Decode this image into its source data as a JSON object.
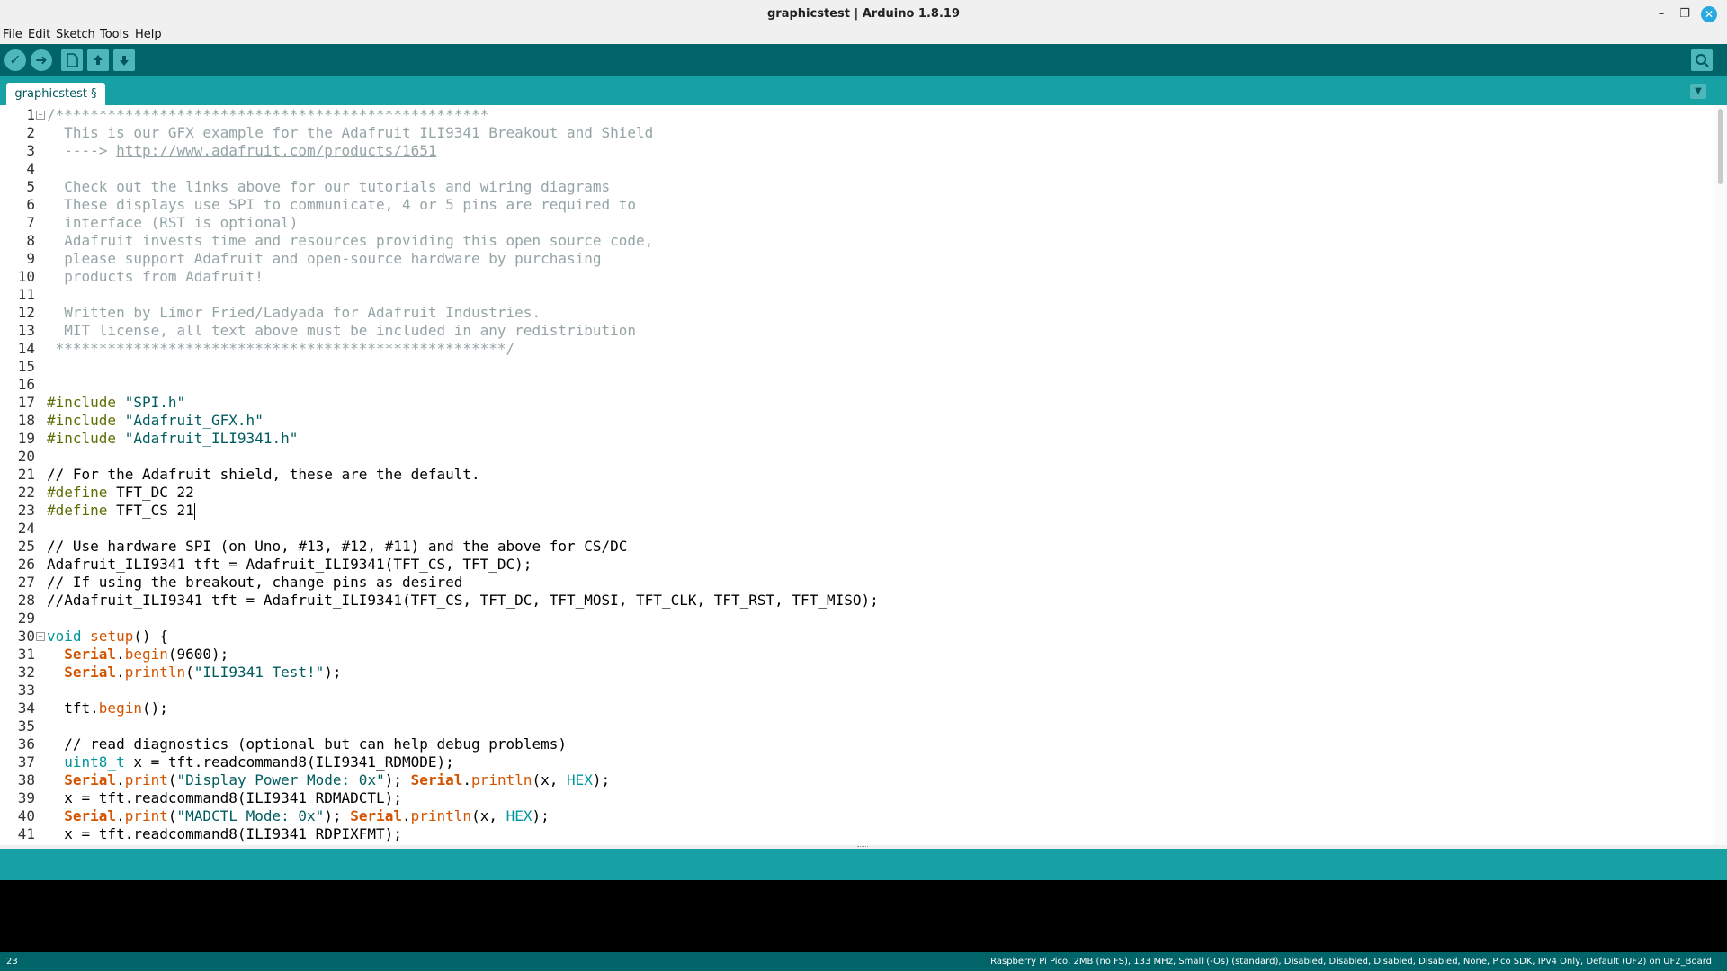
{
  "window": {
    "title": "graphicstest | Arduino 1.8.19",
    "controls": [
      "minimize-icon",
      "restore-icon",
      "close-icon"
    ]
  },
  "menu": [
    "File",
    "Edit",
    "Sketch",
    "Tools",
    "Help"
  ],
  "toolbar": {
    "buttons": [
      "verify-icon",
      "upload-icon",
      "new-icon",
      "open-icon",
      "save-icon"
    ],
    "right": "serial-monitor-icon"
  },
  "tabs": [
    {
      "label": "graphicstest §",
      "active": true
    }
  ],
  "tab_menu_icon": "chevron-down-icon",
  "colors": {
    "toolbar": "#006468",
    "tabbar": "#17a1a5",
    "comment": "#95a5a6",
    "preprocessor": "#5e6d03",
    "keyword": "#00979c",
    "function": "#d35400"
  },
  "editor": {
    "cursor_line": 23,
    "lines": [
      {
        "n": "1",
        "fold": true,
        "tokens": [
          [
            "/**************************************************",
            "comment"
          ]
        ]
      },
      {
        "n": "2",
        "tokens": [
          [
            "  This is our GFX example for the Adafruit ILI9341 Breakout and Shield",
            "comment"
          ]
        ]
      },
      {
        "n": "3",
        "tokens": [
          [
            "  ----> ",
            "comment"
          ],
          [
            "http://www.adafruit.com/products/1651",
            "url"
          ]
        ]
      },
      {
        "n": "4",
        "tokens": []
      },
      {
        "n": "5",
        "tokens": [
          [
            "  Check out the links above for our tutorials and wiring diagrams",
            "comment"
          ]
        ]
      },
      {
        "n": "6",
        "tokens": [
          [
            "  These displays use SPI to communicate, 4 or 5 pins are required to",
            "comment"
          ]
        ]
      },
      {
        "n": "7",
        "tokens": [
          [
            "  interface (RST is optional)",
            "comment"
          ]
        ]
      },
      {
        "n": "8",
        "tokens": [
          [
            "  Adafruit invests time and resources providing this open source code,",
            "comment"
          ]
        ]
      },
      {
        "n": "9",
        "tokens": [
          [
            "  please support Adafruit and open-source hardware by purchasing",
            "comment"
          ]
        ]
      },
      {
        "n": "10",
        "tokens": [
          [
            "  products from Adafruit!",
            "comment"
          ]
        ]
      },
      {
        "n": "11",
        "tokens": []
      },
      {
        "n": "12",
        "tokens": [
          [
            "  Written by Limor Fried/Ladyada for Adafruit Industries.",
            "comment"
          ]
        ]
      },
      {
        "n": "13",
        "tokens": [
          [
            "  MIT license, all text above must be included in any redistribution",
            "comment"
          ]
        ]
      },
      {
        "n": "14",
        "tokens": [
          [
            " ****************************************************/",
            "comment"
          ]
        ]
      },
      {
        "n": "15",
        "tokens": []
      },
      {
        "n": "16",
        "tokens": []
      },
      {
        "n": "17",
        "tokens": [
          [
            "#include",
            "pre"
          ],
          [
            " \"SPI.h\"",
            "str"
          ]
        ]
      },
      {
        "n": "18",
        "tokens": [
          [
            "#include",
            "pre"
          ],
          [
            " \"Adafruit_GFX.h\"",
            "str"
          ]
        ]
      },
      {
        "n": "19",
        "tokens": [
          [
            "#include",
            "pre"
          ],
          [
            " \"Adafruit_ILI9341.h\"",
            "str"
          ]
        ]
      },
      {
        "n": "20",
        "tokens": []
      },
      {
        "n": "21",
        "tokens": [
          [
            "// For the Adafruit shield, these are the default.",
            "plain"
          ]
        ]
      },
      {
        "n": "22",
        "tokens": [
          [
            "#define",
            "pre"
          ],
          [
            " TFT_DC 22",
            "plain"
          ]
        ]
      },
      {
        "n": "23",
        "tokens": [
          [
            "#define",
            "pre"
          ],
          [
            " TFT_CS 21",
            "plain"
          ]
        ],
        "caret": true
      },
      {
        "n": "24",
        "tokens": []
      },
      {
        "n": "25",
        "tokens": [
          [
            "// Use hardware SPI (on Uno, #13, #12, #11) and the above for CS/DC",
            "plain"
          ]
        ]
      },
      {
        "n": "26",
        "tokens": [
          [
            "Adafruit_ILI9341 tft = Adafruit_ILI9341(TFT_CS, TFT_DC);",
            "plain"
          ]
        ]
      },
      {
        "n": "27",
        "tokens": [
          [
            "// If using the breakout, change pins as desired",
            "plain"
          ]
        ]
      },
      {
        "n": "28",
        "tokens": [
          [
            "//Adafruit_ILI9341 tft = Adafruit_ILI9341(TFT_CS, TFT_DC, TFT_MOSI, TFT_CLK, TFT_RST, TFT_MISO);",
            "plain"
          ]
        ]
      },
      {
        "n": "29",
        "tokens": []
      },
      {
        "n": "30",
        "fold": true,
        "tokens": [
          [
            "void",
            "kw"
          ],
          [
            " ",
            "plain"
          ],
          [
            "setup",
            "fn"
          ],
          [
            "() {",
            "plain"
          ]
        ]
      },
      {
        "n": "31",
        "tokens": [
          [
            "  ",
            "plain"
          ],
          [
            "Serial",
            "obj"
          ],
          [
            ".",
            "plain"
          ],
          [
            "begin",
            "fn"
          ],
          [
            "(9600);",
            "plain"
          ]
        ]
      },
      {
        "n": "32",
        "tokens": [
          [
            "  ",
            "plain"
          ],
          [
            "Serial",
            "obj"
          ],
          [
            ".",
            "plain"
          ],
          [
            "println",
            "fn"
          ],
          [
            "(",
            "plain"
          ],
          [
            "\"ILI9341 Test!\"",
            "str"
          ],
          [
            ");",
            "plain"
          ]
        ]
      },
      {
        "n": "33",
        "tokens": []
      },
      {
        "n": "34",
        "tokens": [
          [
            "  tft.",
            "plain"
          ],
          [
            "begin",
            "fn"
          ],
          [
            "();",
            "plain"
          ]
        ]
      },
      {
        "n": "35",
        "tokens": []
      },
      {
        "n": "36",
        "tokens": [
          [
            "  // read diagnostics (optional but can help debug problems)",
            "plain"
          ]
        ]
      },
      {
        "n": "37",
        "tokens": [
          [
            "  ",
            "plain"
          ],
          [
            "uint8_t",
            "kw"
          ],
          [
            " x = tft.readcommand8(ILI9341_RDMODE);",
            "plain"
          ]
        ]
      },
      {
        "n": "38",
        "tokens": [
          [
            "  ",
            "plain"
          ],
          [
            "Serial",
            "obj"
          ],
          [
            ".",
            "plain"
          ],
          [
            "print",
            "fn"
          ],
          [
            "(",
            "plain"
          ],
          [
            "\"Display Power Mode: 0x\"",
            "str"
          ],
          [
            "); ",
            "plain"
          ],
          [
            "Serial",
            "obj"
          ],
          [
            ".",
            "plain"
          ],
          [
            "println",
            "fn"
          ],
          [
            "(x, ",
            "plain"
          ],
          [
            "HEX",
            "kw"
          ],
          [
            ");",
            "plain"
          ]
        ]
      },
      {
        "n": "39",
        "tokens": [
          [
            "  x = tft.readcommand8(ILI9341_RDMADCTL);",
            "plain"
          ]
        ]
      },
      {
        "n": "40",
        "tokens": [
          [
            "  ",
            "plain"
          ],
          [
            "Serial",
            "obj"
          ],
          [
            ".",
            "plain"
          ],
          [
            "print",
            "fn"
          ],
          [
            "(",
            "plain"
          ],
          [
            "\"MADCTL Mode: 0x\"",
            "str"
          ],
          [
            "); ",
            "plain"
          ],
          [
            "Serial",
            "obj"
          ],
          [
            ".",
            "plain"
          ],
          [
            "println",
            "fn"
          ],
          [
            "(x, ",
            "plain"
          ],
          [
            "HEX",
            "kw"
          ],
          [
            ");",
            "plain"
          ]
        ]
      },
      {
        "n": "41",
        "tokens": [
          [
            "  x = tft.readcommand8(ILI9341_RDPIXFMT);",
            "plain"
          ]
        ]
      }
    ]
  },
  "status": {
    "line": "23",
    "board": "Raspberry Pi Pico, 2MB (no FS), 133 MHz, Small (-Os) (standard), Disabled, Disabled, Disabled, Disabled, None, Pico SDK, IPv4 Only, Default (UF2) on UF2_Board"
  }
}
